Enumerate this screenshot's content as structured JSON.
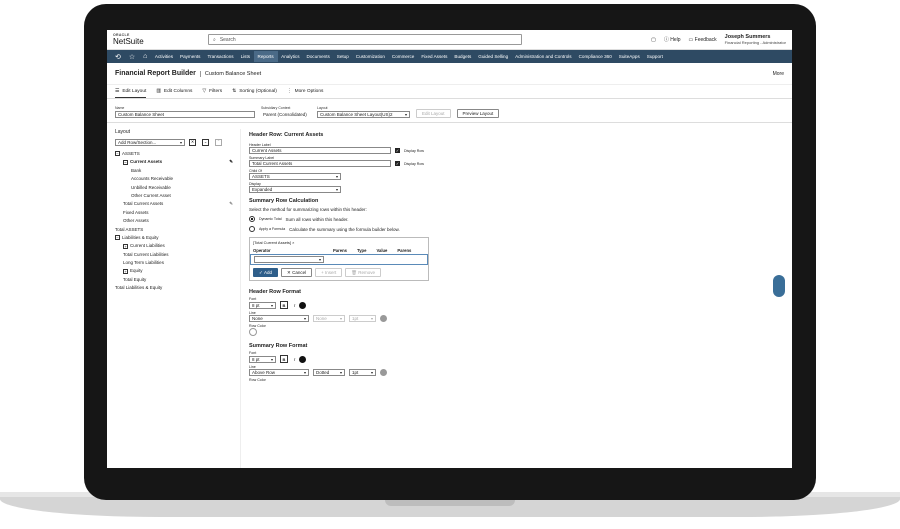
{
  "app": {
    "brand_top": "ORACLE",
    "brand": "NetSuite",
    "search_placeholder": "Search",
    "help": "Help",
    "feedback": "Feedback",
    "user_name": "Joseph Summers",
    "user_role": "Financial Reporting - Administrator"
  },
  "nav": [
    "Activities",
    "Payments",
    "Transactions",
    "Lists",
    "Reports",
    "Analytics",
    "Documents",
    "Setup",
    "Customization",
    "Commerce",
    "Fixed Assets",
    "Budgets",
    "Guided Selling",
    "Administration and Controls",
    "Compliance 360",
    "SuiteApps",
    "Support"
  ],
  "nav_active": "Reports",
  "page": {
    "title": "Financial Report Builder",
    "subtitle": "Custom Balance Sheet",
    "more": "More"
  },
  "tabs": [
    "Edit Layout",
    "Edit Columns",
    "Filters",
    "Sorting (Optional)",
    "More Options"
  ],
  "meta": {
    "name_label": "Name",
    "name_value": "Custom Balance Sheet",
    "ctx_label": "Subsidiary Context",
    "ctx_value": "Parent (Consolidated)",
    "layout_label": "Layout",
    "layout_value": "Custom Balance Sheet Layout(US)2",
    "edit_layout": "Edit Layout",
    "preview_layout": "Preview Layout"
  },
  "left": {
    "title": "Layout",
    "add_placeholder": "Add Row/Section...",
    "tree": [
      {
        "t": "ASSETS",
        "ind": 0,
        "box": "−"
      },
      {
        "t": "Current Assets",
        "ind": 1,
        "box": "−",
        "bold": true,
        "sel": true
      },
      {
        "t": "Bank",
        "ind": 2
      },
      {
        "t": "Accounts Receivable",
        "ind": 2
      },
      {
        "t": "Unbilled Receivable",
        "ind": 2
      },
      {
        "t": "Other Current Asset",
        "ind": 2
      },
      {
        "t": "Total Current Assets",
        "ind": 1
      },
      {
        "t": "Fixed Assets",
        "ind": 1
      },
      {
        "t": "Other Assets",
        "ind": 1
      },
      {
        "t": "Total ASSETS",
        "ind": 0
      },
      {
        "t": "Liabilities & Equity",
        "ind": 0,
        "box": "−"
      },
      {
        "t": "Current Liabilities",
        "ind": 1,
        "box": "+"
      },
      {
        "t": "Total Current Liabilities",
        "ind": 1
      },
      {
        "t": "Long Term Liabilities",
        "ind": 1
      },
      {
        "t": "Equity",
        "ind": 1,
        "box": "+"
      },
      {
        "t": "Total Equity",
        "ind": 1
      },
      {
        "t": "Total Liabilities & Equity",
        "ind": 0
      }
    ]
  },
  "right": {
    "title": "Header Row: Current Assets",
    "header_label_lbl": "Header Label",
    "header_label_val": "Current Assets",
    "display_row": "Display Row",
    "summary_label_lbl": "Summary Label",
    "summary_label_val": "Total Current Assets",
    "child_of_lbl": "Child Of",
    "child_of_val": "ASSETS",
    "display_lbl": "Display",
    "display_val": "Expanded",
    "calc_title": "Summary Row Calculation",
    "calc_desc": "Select the method for summarizing rows within this header:",
    "opt1": "Dynamic Total",
    "opt1_desc": "Sum all rows within this header.",
    "opt2": "Apply a Formula",
    "opt2_desc": "Calculate the summary using the formula builder below.",
    "formula_tag": "[Total Current Assets] ×",
    "cols": [
      "Operator",
      "Parens",
      "Type",
      "Value",
      "Parens"
    ],
    "add": "Add",
    "cancel": "Cancel",
    "insert": "Insert",
    "remove": "Remove",
    "hdr_fmt": "Header Row Format",
    "font": "Font",
    "size1": "8 pt",
    "line": "Line",
    "line1": "None",
    "line1b": "None",
    "line1c": "1pt",
    "row_color": "Row Color",
    "sum_fmt": "Summary Row Format",
    "size2": "8 pt",
    "line2": "Above Row",
    "line2b": "Dotted",
    "line2c": "1pt"
  }
}
